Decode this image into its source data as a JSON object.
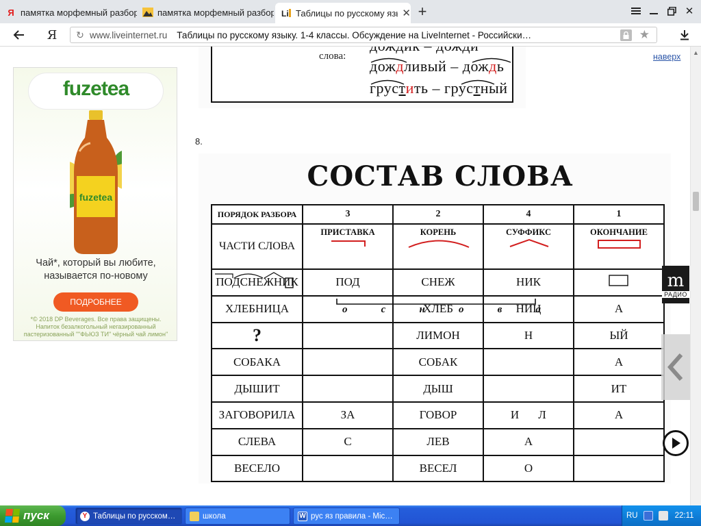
{
  "browser": {
    "tabs": [
      {
        "label": "памятка морфемный разбор",
        "icon": "yandex-icon",
        "active": false
      },
      {
        "label": "памятка морфемный разбор",
        "icon": "image-icon",
        "active": false
      },
      {
        "label": "Таблицы по русскому язы",
        "icon": "liveinternet-icon",
        "active": true
      }
    ],
    "new_tab_label": "+",
    "address": {
      "domain": "www.liveinternet.ru",
      "title": "Таблицы по русскому языку. 1-4 классы. Обсуждение на LiveInternet - Российски…",
      "yandex_label": "Я"
    }
  },
  "page": {
    "scroll_top_link": "наверх",
    "ad": {
      "brand": "fuzetea",
      "bottle_label": "fuzetea",
      "tagline": "Чай*, который вы любите, называется по-новому",
      "button": "ПОДРОБНЕЕ",
      "legal": "*© 2018 DP Beverages. Все права защищены. Напиток безалкогольный негазированный пастеризованный \"\"ФЬЮЗ ТИ\" чёрный чай лимон\""
    },
    "fragment": {
      "label": "слова:",
      "word_top": "дождик – дожди",
      "word1_parts": [
        "дож",
        "д",
        "ливый – дож",
        "д",
        "ь"
      ],
      "word2_parts": [
        "грус",
        "т",
        "и",
        "ть – грус",
        "т",
        "ный"
      ]
    },
    "item_number": "8.",
    "table": {
      "title": "СОСТАВ СЛОВА",
      "header_order": "ПОРЯДОК РАЗБОРА",
      "order_numbers": [
        "3",
        "2",
        "4",
        "1"
      ],
      "parts_label": "ЧАСТИ СЛОВА",
      "parts": [
        "ПРИСТАВКА",
        "КОРЕНЬ",
        "СУФФИКС",
        "ОКОНЧАНИЕ"
      ],
      "osnova_letters": [
        "о",
        "с",
        "н",
        "о",
        "в",
        "а"
      ],
      "rows": [
        {
          "word": "ПОДСНЕЖНИК",
          "prefix": "ПОД",
          "root": "СНЕЖ",
          "suffix": "НИК",
          "ending": ""
        },
        {
          "word": "ХЛЕБНИЦА",
          "prefix": "",
          "root": "ХЛЕБ",
          "suffix": "НИЦ",
          "ending": "А"
        },
        {
          "word": "?",
          "prefix": "",
          "root": "ЛИМОН",
          "suffix": "Н",
          "ending": "ЫЙ"
        },
        {
          "word": "СОБАКА",
          "prefix": "",
          "root": "СОБАК",
          "suffix": "",
          "ending": "А"
        },
        {
          "word": "ДЫШИТ",
          "prefix": "",
          "root": "ДЫШ",
          "suffix": "",
          "ending": "ИТ"
        },
        {
          "word": "ЗАГОВОРИЛА",
          "prefix": "ЗА",
          "root": "ГОВОР",
          "suffix": "И",
          "suffix2": "Л",
          "ending": "А"
        },
        {
          "word": "СЛЕВА",
          "prefix": "С",
          "root": "ЛЕВ",
          "suffix": "А",
          "ending": ""
        },
        {
          "word": "ВЕСЕЛО",
          "prefix": "",
          "root": "ВЕСЕЛ",
          "suffix": "О",
          "ending": ""
        }
      ]
    },
    "radio_widget": {
      "letter": "m",
      "label": "РАДИО"
    }
  },
  "taskbar": {
    "start_label": "пуск",
    "items": [
      {
        "label": "Таблицы по русском…",
        "icon": "yandex-browser-icon",
        "active": true
      },
      {
        "label": "школа",
        "icon": "folder-icon",
        "active": false
      },
      {
        "label": "рус яз правила - Mic…",
        "icon": "word-icon",
        "active": false
      }
    ],
    "language": "RU",
    "clock": "22:11"
  },
  "colors": {
    "accent_red": "#d21e1e",
    "ad_button": "#f05a23",
    "ad_brand": "#2f8a2a",
    "link": "#2b55a8",
    "taskbar": "#245edc",
    "start": "#3c9a2f"
  }
}
